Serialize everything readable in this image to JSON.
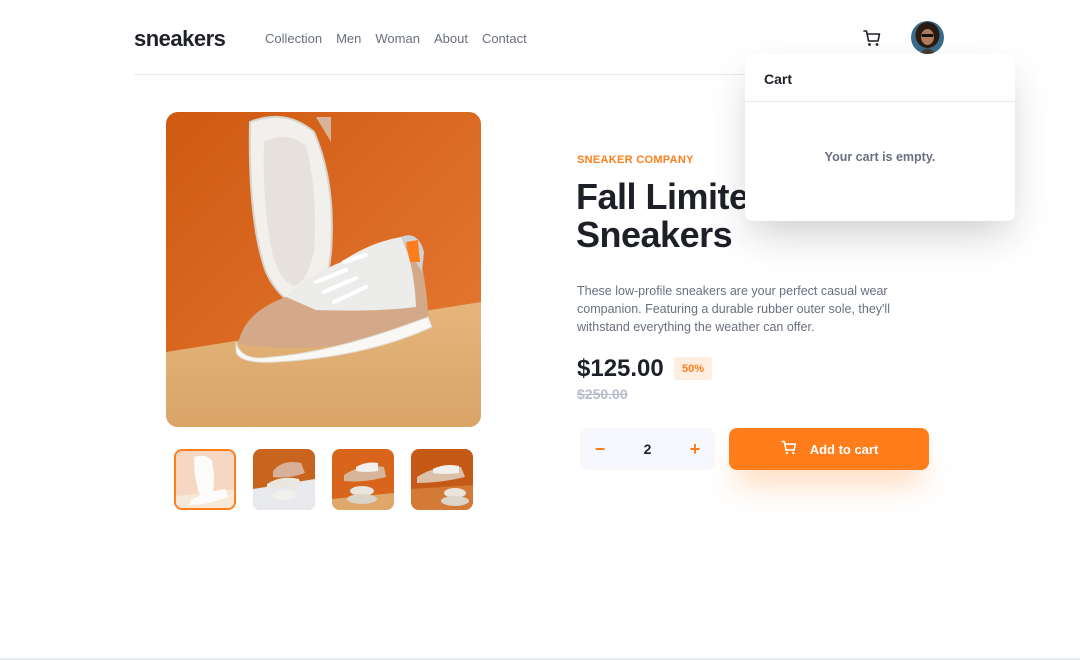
{
  "header": {
    "logo": "sneakers",
    "nav": [
      "Collection",
      "Men",
      "Woman",
      "About",
      "Contact"
    ]
  },
  "icons": {
    "cart": "cart-icon",
    "avatar": "user-avatar",
    "minus": "minus-icon",
    "plus": "plus-icon"
  },
  "product": {
    "company": "SNEAKER COMPANY",
    "title": "Fall Limited Edition Sneakers",
    "description": "These low-profile sneakers are your perfect casual wear companion. Featuring a durable rubber outer sole, they'll withstand everything the weather can offer.",
    "price": "$125.00",
    "discount": "50%",
    "old_price": "$250.00"
  },
  "quantity": {
    "minus": "−",
    "value": "2",
    "plus": "+"
  },
  "add_to_cart": "Add to cart",
  "cart": {
    "heading": "Cart",
    "empty_message": "Your cart is empty."
  },
  "colors": {
    "accent": "#ff7e1b",
    "accent_pale": "#ffede0",
    "text_dark": "#1d2026",
    "text_muted": "#69707d",
    "text_light": "#b6bcc8"
  },
  "gallery": {
    "thumbnail_count": 4,
    "active_thumbnail": 1
  }
}
